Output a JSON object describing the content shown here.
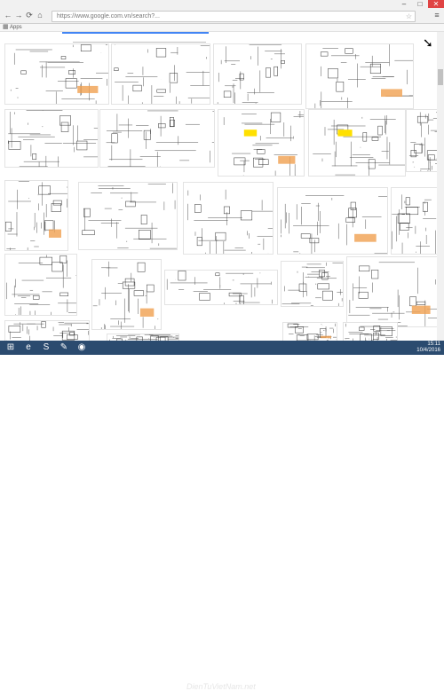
{
  "browser": {
    "url": "https://www.google.com.vn/search?...",
    "bookmark_label": "Apps"
  },
  "window_controls": {
    "minimize": "–",
    "maximize": "□",
    "close": "✕"
  },
  "icons": {
    "back": "arrow-left-icon",
    "forward": "arrow-right-icon",
    "reload": "reload-icon",
    "home": "home-icon",
    "star": "star-icon",
    "menu": "menu-icon"
  },
  "taskbar": {
    "items": [
      "windows-start-icon",
      "ie-icon",
      "skype-icon",
      "paint-icon",
      "chrome-icon"
    ],
    "watermark": "DienTuVietNam.net",
    "clock_time": "15:11",
    "clock_date": "10/4/2016"
  },
  "results": [
    {
      "name": "schematic-thumb-1"
    },
    {
      "name": "schematic-thumb-2"
    },
    {
      "name": "schematic-thumb-3"
    },
    {
      "name": "schematic-thumb-4"
    },
    {
      "name": "schematic-thumb-5"
    },
    {
      "name": "schematic-thumb-6"
    },
    {
      "name": "schematic-thumb-7"
    },
    {
      "name": "schematic-thumb-8"
    },
    {
      "name": "schematic-thumb-9"
    },
    {
      "name": "schematic-thumb-10"
    },
    {
      "name": "schematic-thumb-11"
    },
    {
      "name": "schematic-thumb-12"
    },
    {
      "name": "schematic-thumb-13"
    },
    {
      "name": "schematic-thumb-14"
    },
    {
      "name": "schematic-thumb-15"
    },
    {
      "name": "schematic-thumb-16"
    },
    {
      "name": "schematic-thumb-17"
    },
    {
      "name": "schematic-thumb-18"
    },
    {
      "name": "schematic-thumb-19"
    },
    {
      "name": "schematic-thumb-20"
    },
    {
      "name": "schematic-thumb-21"
    },
    {
      "name": "schematic-thumb-22"
    },
    {
      "name": "schematic-thumb-23"
    }
  ]
}
